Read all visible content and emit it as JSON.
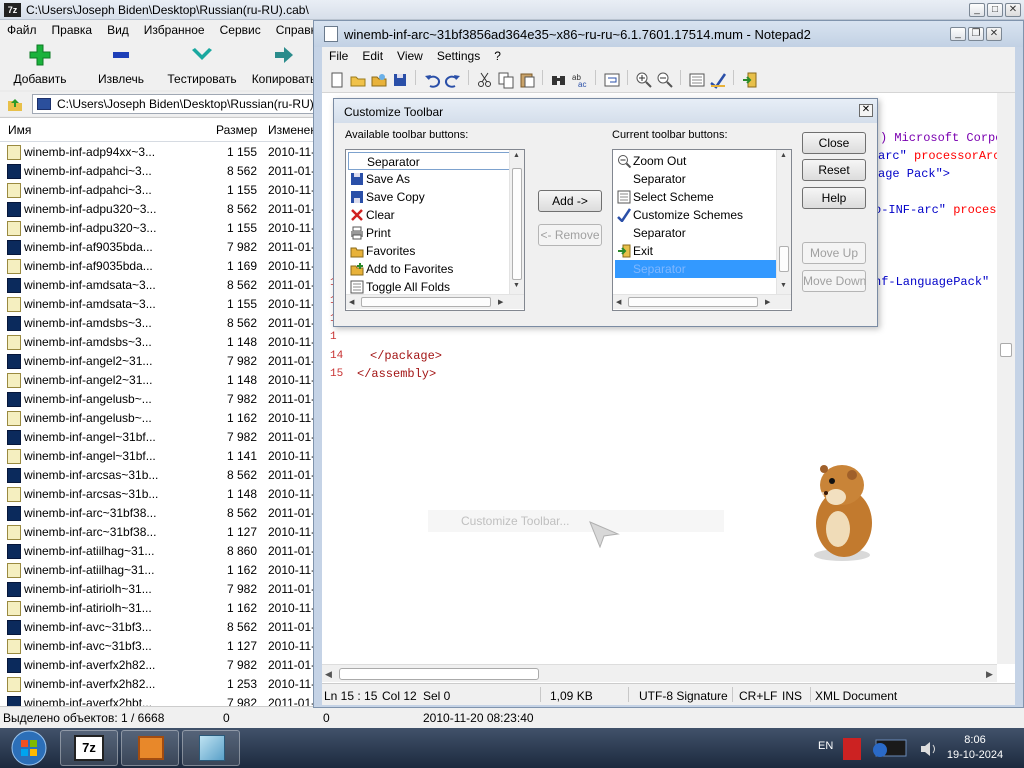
{
  "zip": {
    "title": "C:\\Users\\Joseph Biden\\Desktop\\Russian(ru-RU).cab\\",
    "menu": [
      "Файл",
      "Правка",
      "Вид",
      "Избранное",
      "Сервис",
      "Справка"
    ],
    "toolbar": {
      "add": "Добавить",
      "extract": "Извлечь",
      "test": "Тестировать",
      "copy": "Копировать"
    },
    "address": "C:\\Users\\Joseph Biden\\Desktop\\Russian(ru-RU).c",
    "columns": {
      "name": "Имя",
      "size": "Размер",
      "modified": "Изменен"
    },
    "rows": [
      {
        "name": "winemb-inf-adp94xx~3...",
        "size": "1 155",
        "date": "2010-11-"
      },
      {
        "name": "winemb-inf-adpahci~3...",
        "size": "8 562",
        "date": "2011-01-"
      },
      {
        "name": "winemb-inf-adpahci~3...",
        "size": "1 155",
        "date": "2010-11-"
      },
      {
        "name": "winemb-inf-adpu320~3...",
        "size": "8 562",
        "date": "2011-01-"
      },
      {
        "name": "winemb-inf-adpu320~3...",
        "size": "1 155",
        "date": "2010-11-"
      },
      {
        "name": "winemb-inf-af9035bda...",
        "size": "7 982",
        "date": "2011-01-"
      },
      {
        "name": "winemb-inf-af9035bda...",
        "size": "1 169",
        "date": "2010-11-"
      },
      {
        "name": "winemb-inf-amdsata~3...",
        "size": "8 562",
        "date": "2011-01-"
      },
      {
        "name": "winemb-inf-amdsata~3...",
        "size": "1 155",
        "date": "2010-11-"
      },
      {
        "name": "winemb-inf-amdsbs~3...",
        "size": "8 562",
        "date": "2011-01-"
      },
      {
        "name": "winemb-inf-amdsbs~3...",
        "size": "1 148",
        "date": "2010-11-"
      },
      {
        "name": "winemb-inf-angel2~31...",
        "size": "7 982",
        "date": "2011-01-"
      },
      {
        "name": "winemb-inf-angel2~31...",
        "size": "1 148",
        "date": "2010-11-"
      },
      {
        "name": "winemb-inf-angelusb~...",
        "size": "7 982",
        "date": "2011-01-"
      },
      {
        "name": "winemb-inf-angelusb~...",
        "size": "1 162",
        "date": "2010-11-"
      },
      {
        "name": "winemb-inf-angel~31bf...",
        "size": "7 982",
        "date": "2011-01-"
      },
      {
        "name": "winemb-inf-angel~31bf...",
        "size": "1 141",
        "date": "2010-11-"
      },
      {
        "name": "winemb-inf-arcsas~31b...",
        "size": "8 562",
        "date": "2011-01-"
      },
      {
        "name": "winemb-inf-arcsas~31b...",
        "size": "1 148",
        "date": "2010-11-"
      },
      {
        "name": "winemb-inf-arc~31bf38...",
        "size": "8 562",
        "date": "2011-01-"
      },
      {
        "name": "winemb-inf-arc~31bf38...",
        "size": "1 127",
        "date": "2010-11-"
      },
      {
        "name": "winemb-inf-atiilhag~31...",
        "size": "8 860",
        "date": "2011-01-"
      },
      {
        "name": "winemb-inf-atiilhag~31...",
        "size": "1 162",
        "date": "2010-11-"
      },
      {
        "name": "winemb-inf-atiriolh~31...",
        "size": "7 982",
        "date": "2011-01-"
      },
      {
        "name": "winemb-inf-atiriolh~31...",
        "size": "1 162",
        "date": "2010-11-"
      },
      {
        "name": "winemb-inf-avc~31bf3...",
        "size": "8 562",
        "date": "2011-01-"
      },
      {
        "name": "winemb-inf-avc~31bf3...",
        "size": "1 127",
        "date": "2010-11-"
      },
      {
        "name": "winemb-inf-averfx2h82...",
        "size": "7 982",
        "date": "2011-01-"
      },
      {
        "name": "winemb-inf-averfx2h82...",
        "size": "1 253",
        "date": "2010-11-"
      },
      {
        "name": "winemb-inf-averfx2hbt...",
        "size": "7 982",
        "date": "2011-01-"
      }
    ],
    "status": {
      "selected": "Выделено объектов: 1 / 6668",
      "size1": "0",
      "size2": "0",
      "modified": "2010-11-20 08:23:40"
    }
  },
  "notepad": {
    "title": "winemb-inf-arc~31bf3856ad364e35~x86~ru-ru~6.1.7601.17514.mum - Notepad2",
    "menu": [
      "File",
      "Edit",
      "View",
      "Settings",
      "?"
    ],
    "code_fragments": {
      "r1": ") Microsoft Corpor",
      "r2a": "arc\"",
      "r2b": " processorArch",
      "r3": "age Pack\">",
      "r4a": "o-INF-arc\"",
      "r4b": " process",
      "r5a": "nf-LanguagePack\"",
      "r5b": " p",
      "line14": "</package>",
      "line15": "</assembly>"
    },
    "line_numbers": [
      "14",
      "15"
    ],
    "status": {
      "pos": "Ln 15 : 15",
      "col": "Col 12",
      "sel": "Sel 0",
      "size": "1,09 KB",
      "encoding": "UTF-8 Signature",
      "eol": "CR+LF",
      "ins": "INS",
      "scheme": "XML Document"
    }
  },
  "dialog": {
    "title": "Customize Toolbar",
    "available_label": "Available toolbar buttons:",
    "current_label": "Current toolbar buttons:",
    "available": [
      {
        "label": "Separator",
        "icon": "none"
      },
      {
        "label": "Save As",
        "icon": "save-as-icon"
      },
      {
        "label": "Save Copy",
        "icon": "save-copy-icon"
      },
      {
        "label": "Clear",
        "icon": "clear-icon"
      },
      {
        "label": "Print",
        "icon": "print-icon"
      },
      {
        "label": "Favorites",
        "icon": "favorites-icon"
      },
      {
        "label": "Add to Favorites",
        "icon": "add-favorites-icon"
      },
      {
        "label": "Toggle All Folds",
        "icon": "toggle-folds-icon"
      }
    ],
    "current": [
      {
        "label": "Zoom Out",
        "icon": "zoom-out-icon"
      },
      {
        "label": "Separator",
        "icon": "none"
      },
      {
        "label": "Select Scheme",
        "icon": "select-scheme-icon"
      },
      {
        "label": "Customize Schemes",
        "icon": "customize-schemes-icon"
      },
      {
        "label": "Separator",
        "icon": "none"
      },
      {
        "label": "Exit",
        "icon": "exit-icon"
      },
      {
        "label": "Separator",
        "icon": "none"
      }
    ],
    "buttons": {
      "add": "Add ->",
      "remove": "<- Remove",
      "close": "Close",
      "reset": "Reset",
      "help": "Help",
      "move_up": "Move Up",
      "move_down": "Move Down"
    }
  },
  "ghost_tooltip": "Customize Toolbar...",
  "taskbar": {
    "lang": "EN",
    "time": "8:06",
    "date": "19-10-2024"
  },
  "colors": {
    "selection": "#3399ff",
    "xml_tag": "#a31515",
    "xml_attr": "#ff0000",
    "taskbar": "#2a3a52"
  }
}
